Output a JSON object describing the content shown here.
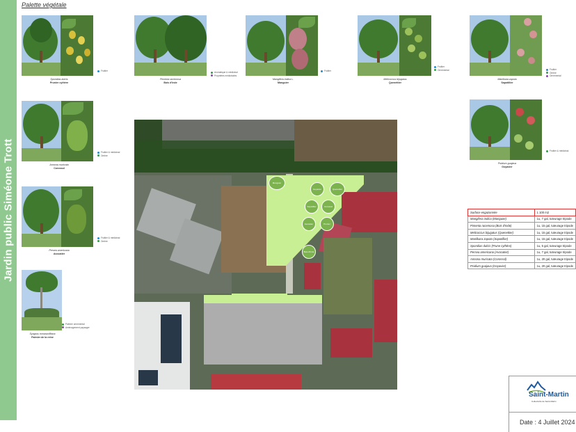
{
  "sidebar": {
    "title": "Jardin public Siméone Trott"
  },
  "palette": {
    "title": "Palette végétale"
  },
  "plants": [
    {
      "scientific": "Spondias dulcis",
      "common": "Prunier cythère",
      "legend": [
        "Fruitier"
      ],
      "fruit_color": "#d9c03a"
    },
    {
      "scientific": "Pimenta racemosa",
      "common": "Bois d'Inde",
      "legend": [
        "Aromatique & médicinal",
        "Propriétés médicinales"
      ],
      "fruit_color": "#3f7a2f"
    },
    {
      "scientific": "Mangifera indica L.",
      "common": "Manguier",
      "legend": [
        "Fruitier"
      ],
      "fruit_color": "#c0808a"
    },
    {
      "scientific": "Melicoccus bijugatus",
      "common": "Quenettier",
      "legend": [
        "Fruitier",
        "Ornemental"
      ],
      "fruit_color": "#9cc05a"
    },
    {
      "scientific": "Manilkara zapota",
      "common": "Sapotillier",
      "legend": [
        "Fruitier",
        "Ombre",
        "Ornemental"
      ],
      "fruit_color": "#d8a0a0"
    },
    {
      "scientific": "Annona muricata",
      "common": "Corossol",
      "legend": [
        "Fruitier & médicinal",
        "Ombre"
      ],
      "fruit_color": "#7fb04a"
    },
    {
      "scientific": "Psidium guajava",
      "common": "Goyavier",
      "legend": [
        "Fruitier & médicinal"
      ],
      "fruit_color": "#c9484a"
    },
    {
      "scientific": "Persea americana",
      "common": "Avocatier",
      "legend": [
        "Fruitier & médicinal",
        "Ombre"
      ],
      "fruit_color": "#6f9a3a"
    },
    {
      "scientific": "Syagrus romanzoffiana",
      "common": "Palmier de la reine",
      "legend": [
        "Palmier ornemental",
        "Aménagement paysager"
      ],
      "fruit_color": "#3f7a2f"
    }
  ],
  "legend_colors": [
    "#1a8fd0",
    "#8e44ad",
    "#2e9e4a"
  ],
  "plan": {
    "labels": [
      "Manguier",
      "Quenettier",
      "Goyavier",
      "Sapotillier",
      "Corossol",
      "Avocatier",
      "Prunier",
      "Bois d'Inde"
    ]
  },
  "table": {
    "header": {
      "label": "Surface engazonnée",
      "value": "1 100 m2"
    },
    "rows": [
      {
        "label": "Mangifera indica (Manguier)",
        "value": "1u, 7 gal, tuteurage tripode"
      },
      {
        "label": "Pimenta racemosa (Bois d'Inde)",
        "value": "1u, 15 gal, tuteurage tripode"
      },
      {
        "label": "Melicoccus bijugatus (Quenettier)",
        "value": "1u, 15 gal, tuteurage tripode"
      },
      {
        "label": "Manilkara zapota (Sapotillier)",
        "value": "1u, 15 gal, tuteurage tripode"
      },
      {
        "label": "Spondias dulcis (Prune cythère)",
        "value": "1u, 5 gal, tuteurage tripode"
      },
      {
        "label": "Persea americana (Avocatier)",
        "value": "1u, 7 gal, tuteurage tripode"
      },
      {
        "label": "Annona muricata (Corossol)",
        "value": "1u, 20 gal, tuteurage tripode"
      },
      {
        "label": "Psidium guajava (Goyavier)",
        "value": "1u, 20 gal, tuteurage tripode"
      }
    ]
  },
  "logo": {
    "name": "Saint-Martin",
    "tagline": "Collectivité de Saint-Martin"
  },
  "footer": {
    "date": "Date : 4 Juillet 2024"
  }
}
